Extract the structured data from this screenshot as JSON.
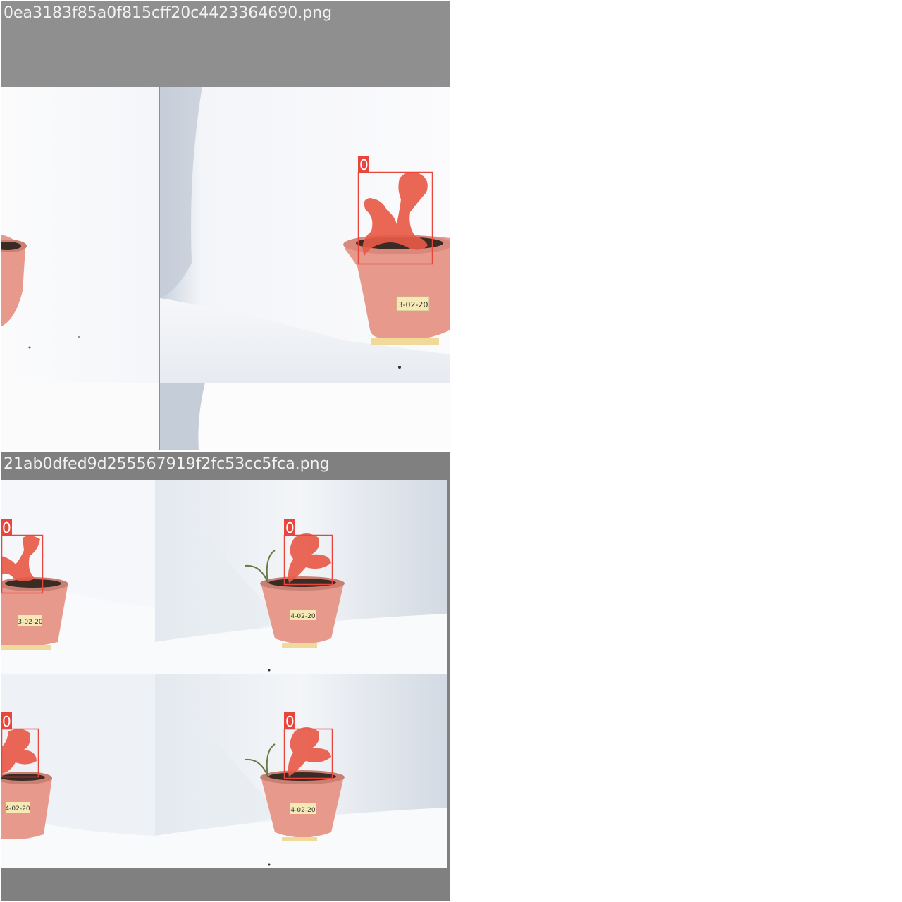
{
  "mosaic": {
    "tiles": [
      {
        "filename": "0ea3183f85a0f815cff20c4423364690.png",
        "detections": [
          {
            "class_label": "0"
          }
        ]
      },
      {
        "filename": "21ab0dfed9d255567919f2fc53cc5fca.png",
        "detections": [
          {
            "class_label": "0"
          },
          {
            "class_label": "0"
          },
          {
            "class_label": "0"
          },
          {
            "class_label": "0"
          }
        ]
      }
    ],
    "pot_labels": [
      "3-02-20",
      "3-02-20",
      "4-02-20",
      "4-02-20",
      "4-02-20"
    ],
    "colors": {
      "detection": "#e8453c",
      "mask": "#e85a48",
      "pot": "#e79a8c",
      "title_band_1": "#8f8f8f",
      "title_band_2": "#808080",
      "title_text": "#f2f2f2"
    }
  }
}
